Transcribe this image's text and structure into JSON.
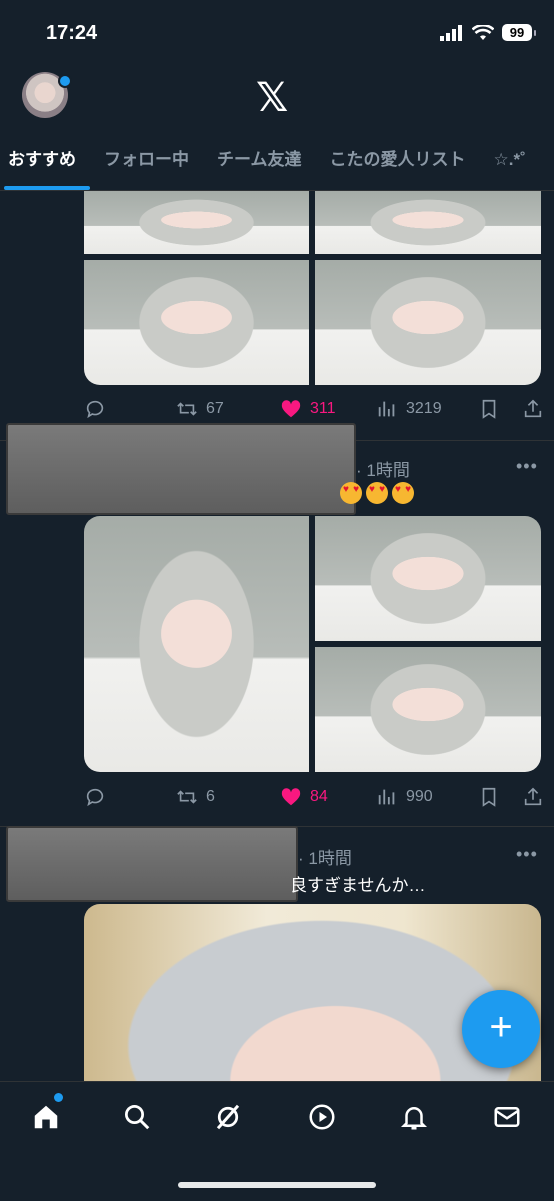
{
  "status_bar": {
    "time": "17:24",
    "battery": "99"
  },
  "header": {
    "logo": "𝕏"
  },
  "tabs": [
    {
      "label": "おすすめ",
      "active": true
    },
    {
      "label": "フォロー中",
      "active": false
    },
    {
      "label": "チーム友達",
      "active": false
    },
    {
      "label": "こたの愛人リスト",
      "active": false
    },
    {
      "label": "☆.*˚",
      "active": false
    }
  ],
  "posts": [
    {
      "replies": "",
      "reposts": "67",
      "likes": "311",
      "views": "3219",
      "liked": true
    },
    {
      "time": "· 1時間",
      "text": "",
      "replies": "",
      "reposts": "6",
      "likes": "84",
      "views": "990",
      "liked": true
    },
    {
      "time": "· 1時間",
      "text": "良すぎませんか…"
    }
  ],
  "fab": {
    "label": "+"
  },
  "colors": {
    "background": "#15202b",
    "accent": "#1d9bf0",
    "like": "#f91880",
    "muted": "#8b98a5"
  },
  "nav": [
    "home-icon",
    "search-icon",
    "grok-icon",
    "video-icon",
    "bell-icon",
    "mail-icon"
  ]
}
